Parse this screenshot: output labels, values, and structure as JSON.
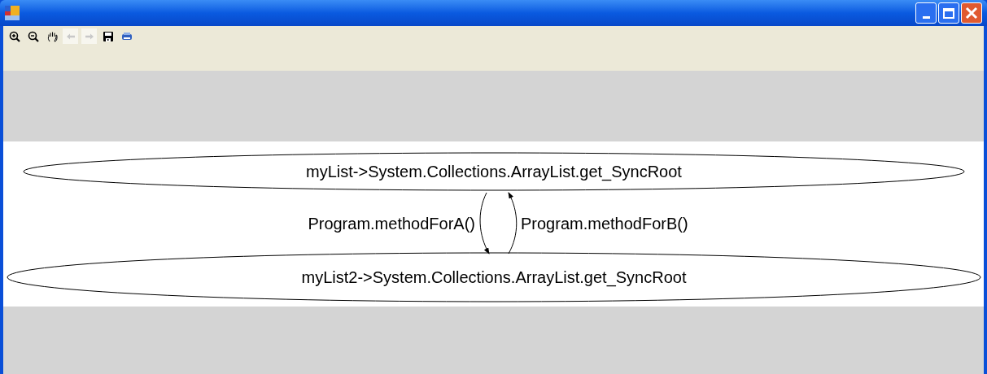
{
  "toolbar": [
    {
      "kind": "zoom-in",
      "disabled": false
    },
    {
      "kind": "zoom-out",
      "disabled": false
    },
    {
      "kind": "pan",
      "disabled": false
    },
    {
      "kind": "back",
      "disabled": true
    },
    {
      "kind": "forward",
      "disabled": true
    },
    {
      "kind": "save",
      "disabled": false
    },
    {
      "kind": "print",
      "disabled": false
    }
  ],
  "graph": {
    "nodes": [
      "myList->System.Collections.ArrayList.get_SyncRoot",
      "myList2->System.Collections.ArrayList.get_SyncRoot"
    ],
    "edges": [
      {
        "label": "Program.methodForA()",
        "kind": "down"
      },
      {
        "label": "Program.methodForB()",
        "kind": "up"
      }
    ]
  }
}
